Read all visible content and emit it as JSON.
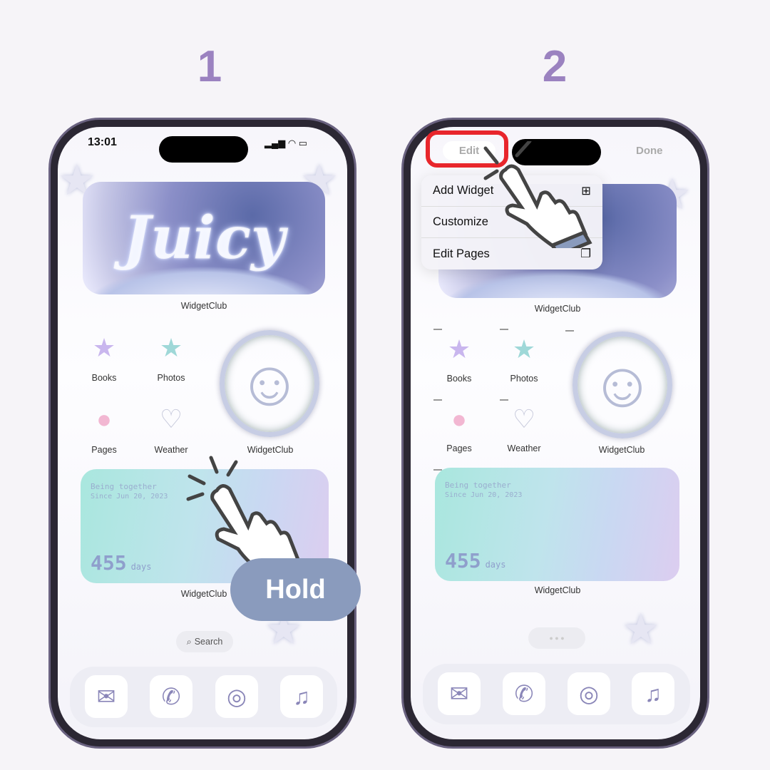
{
  "steps": [
    "1",
    "2"
  ],
  "phone1": {
    "status_time": "13:01",
    "widgets": {
      "juicy_text": "Juicy",
      "juicy_label": "WidgetClub",
      "smiley_label": "WidgetClub",
      "counter_label": "WidgetClub"
    },
    "apps": [
      {
        "label": "Books",
        "icon": "star-icon"
      },
      {
        "label": "Photos",
        "icon": "star-icon"
      },
      {
        "label": "Pages",
        "icon": "gummy-bear-icon"
      },
      {
        "label": "Weather",
        "icon": "heart-icon"
      }
    ],
    "counter": {
      "line1": "Being together",
      "line2": "Since Jun 20, 2023",
      "number": "455",
      "unit": "days"
    },
    "search_label": "Search",
    "dock": [
      "mail-icon",
      "phone-icon",
      "compass-icon",
      "music-icon"
    ],
    "hold_label": "Hold"
  },
  "phone2": {
    "edit_label": "Edit",
    "done_label": "Done",
    "menu": [
      {
        "label": "Add Widget",
        "icon": "add-widget-icon"
      },
      {
        "label": "Customize",
        "icon": ""
      },
      {
        "label": "Edit Pages",
        "icon": "pages-icon"
      }
    ],
    "widgets": {
      "juicy_label": "WidgetClub",
      "smiley_label": "WidgetClub",
      "counter_label": "WidgetClub"
    },
    "apps": [
      {
        "label": "Books"
      },
      {
        "label": "Photos"
      },
      {
        "label": "Pages"
      },
      {
        "label": "Weather"
      }
    ],
    "counter": {
      "line1": "Being together",
      "line2": "Since Jun 20, 2023",
      "number": "455",
      "unit": "days"
    }
  },
  "colors": {
    "accent": "#9b82c0",
    "hold_pill": "#8a9bbd",
    "highlight": "#e8262c"
  }
}
